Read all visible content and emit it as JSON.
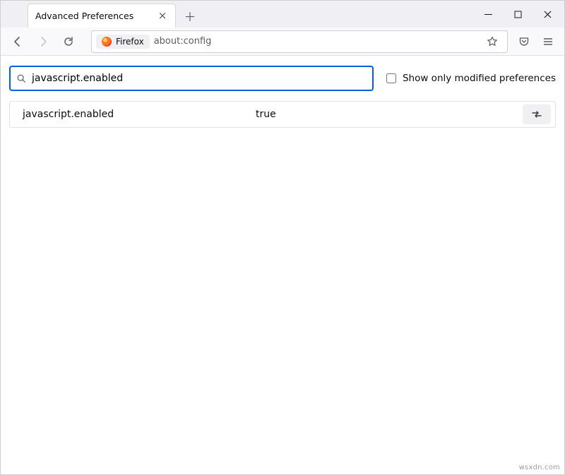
{
  "tab": {
    "title": "Advanced Preferences"
  },
  "urlbar": {
    "pill_label": "Firefox",
    "url_text": "about:config"
  },
  "search": {
    "value": "javascript.enabled",
    "checkbox_label": "Show only modified preferences",
    "checkbox_checked": false
  },
  "result": {
    "name": "javascript.enabled",
    "value": "true"
  },
  "watermark": "wsxdn.com"
}
